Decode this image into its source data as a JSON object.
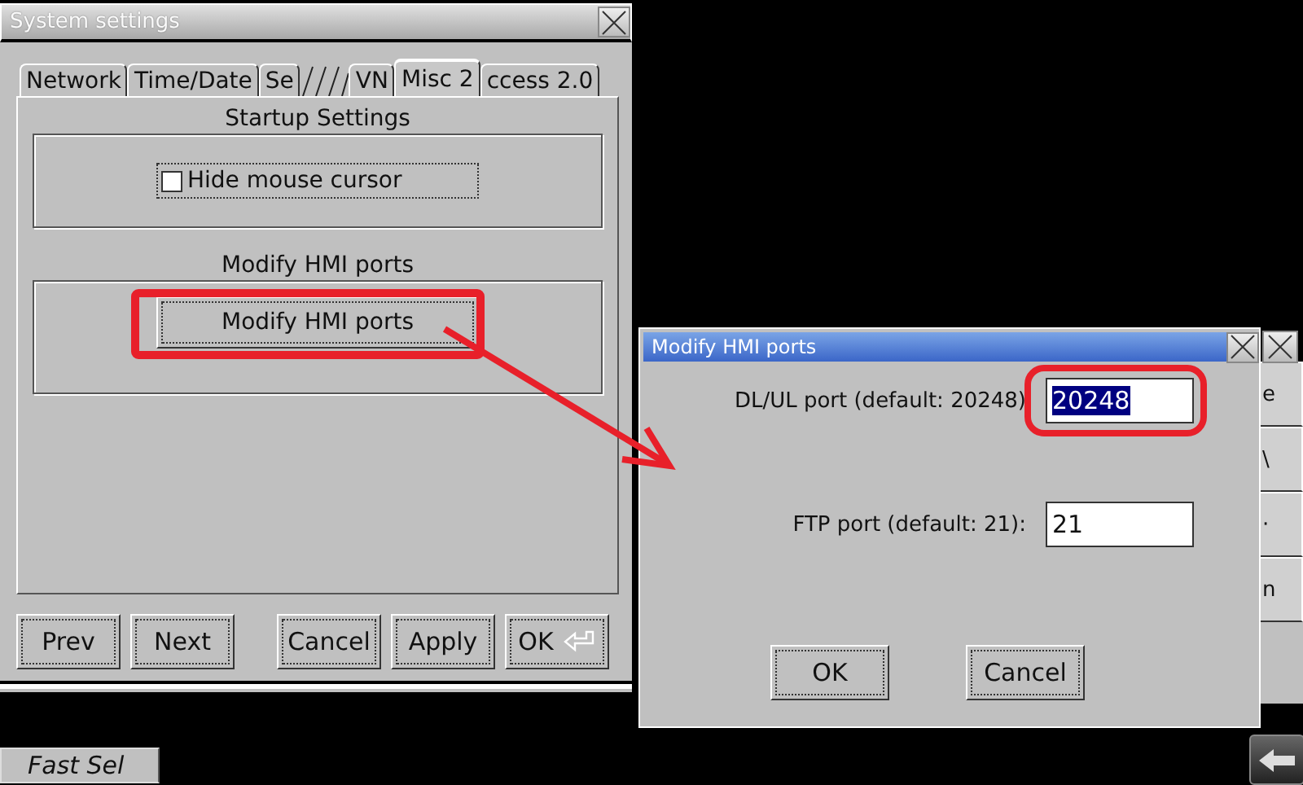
{
  "settings_window": {
    "title": "System settings",
    "tabs": [
      {
        "label": "Network",
        "selected": false
      },
      {
        "label": "Time/Date",
        "selected": false
      },
      {
        "label": "Se",
        "selected": false
      },
      {
        "label": "VN",
        "selected": false
      },
      {
        "label": "Misc 2",
        "selected": true
      },
      {
        "label": "ccess 2.0",
        "selected": false
      }
    ],
    "groups": [
      {
        "title": "Startup Settings",
        "kind": "checkbox",
        "label": "Hide mouse cursor",
        "checked": false
      },
      {
        "title": "Modify HMI ports",
        "kind": "button",
        "label": "Modify HMI ports"
      }
    ],
    "buttons": [
      {
        "label": "Prev"
      },
      {
        "label": "Next"
      },
      {
        "label": "Cancel"
      },
      {
        "label": "Apply"
      },
      {
        "label": "OK",
        "enter_icon": true
      }
    ]
  },
  "taskbar": {
    "fast_sel": "Fast Sel"
  },
  "background_buttons": [
    {
      "label": "e"
    },
    {
      "label": "\\"
    },
    {
      "label": "·"
    },
    {
      "label": "n"
    }
  ],
  "dialog": {
    "title": "Modify HMI ports",
    "fields": [
      {
        "label": "DL/UL port (default: 20248)",
        "value": "20248",
        "text_selected": true
      },
      {
        "label": "FTP port (default: 21):",
        "value": "21",
        "text_selected": false
      }
    ],
    "buttons": [
      {
        "label": "OK"
      },
      {
        "label": "Cancel"
      }
    ]
  }
}
